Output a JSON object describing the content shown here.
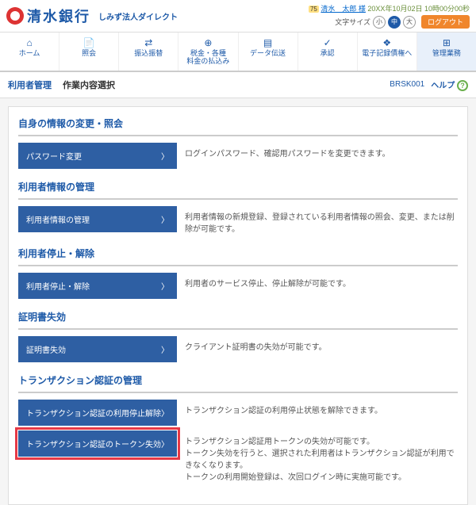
{
  "header": {
    "bank_name": "清水銀行",
    "sub_title": "しみず法人ダイレクト",
    "uid_prefix": "75",
    "user_name": "清水　太郎 様",
    "datetime": "20XX年10月02日 10時00分00秒",
    "font_label": "文字サイズ",
    "font_small": "小",
    "font_mid": "中",
    "font_large": "大",
    "logout": "ログアウト"
  },
  "nav": {
    "items": [
      {
        "label": "ホーム"
      },
      {
        "label": "照会"
      },
      {
        "label": "振込振替"
      },
      {
        "label": "税金・各種\n料金の払込み"
      },
      {
        "label": "データ伝送"
      },
      {
        "label": "承認"
      },
      {
        "label": "電子記録債権へ"
      },
      {
        "label": "管理業務"
      }
    ]
  },
  "breadcrumb": {
    "link": "利用者管理",
    "current": "作業内容選択",
    "code": "BRSK001",
    "help": "ヘルプ"
  },
  "sections": [
    {
      "title": "自身の情報の変更・照会",
      "items": [
        {
          "btn": "パスワード変更",
          "desc": "ログインパスワード、確認用パスワードを変更できます。"
        }
      ]
    },
    {
      "title": "利用者情報の管理",
      "items": [
        {
          "btn": "利用者情報の管理",
          "desc": "利用者情報の新規登録、登録されている利用者情報の照会、変更、または削除が可能です。"
        }
      ]
    },
    {
      "title": "利用者停止・解除",
      "items": [
        {
          "btn": "利用者停止・解除",
          "desc": "利用者のサービス停止、停止解除が可能です。"
        }
      ]
    },
    {
      "title": "証明書失効",
      "items": [
        {
          "btn": "証明書失効",
          "desc": "クライアント証明書の失効が可能です。"
        }
      ]
    },
    {
      "title": "トランザクション認証の管理",
      "items": [
        {
          "btn": "トランザクション認証の利用停止解除",
          "desc": "トランザクション認証の利用停止状態を解除できます。"
        },
        {
          "btn": "トランザクション認証のトークン失効",
          "desc": "トランザクション認証用トークンの失効が可能です。\nトークン失効を行うと、選択された利用者はトランザクション認証が利用できなくなります。\nトークンの利用開始登録は、次回ログイン時に実施可能です。",
          "hl": true
        }
      ]
    }
  ]
}
